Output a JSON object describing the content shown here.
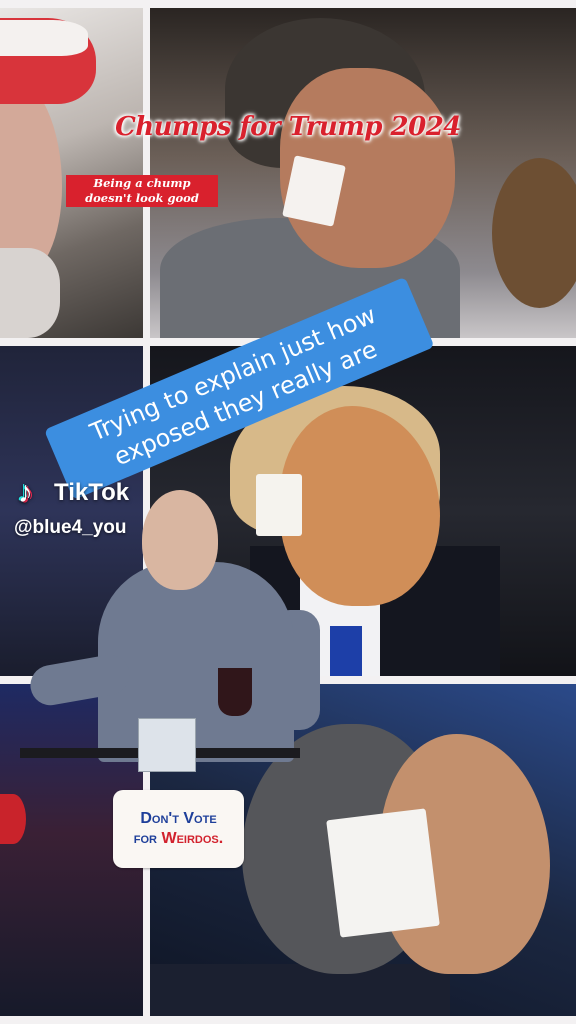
{
  "overlay": {
    "title": "Chumps for Trump 2024",
    "subtitle": "Being a chump doesn't look good",
    "caption": "Trying to explain just how exposed they really are",
    "watermark": {
      "brand": "TikTok",
      "handle": "@blue4_you"
    },
    "sticker": {
      "line1": "Don't Vote",
      "line2_prefix": "for",
      "line2_emphasis": "Weirdos."
    }
  },
  "colors": {
    "title_red": "#d9212d",
    "caption_blue": "#3c8ee0",
    "sticker_blue": "#1e3f9a",
    "sticker_red": "#d2222d"
  },
  "icons": [
    "tiktok-logo-icon"
  ]
}
